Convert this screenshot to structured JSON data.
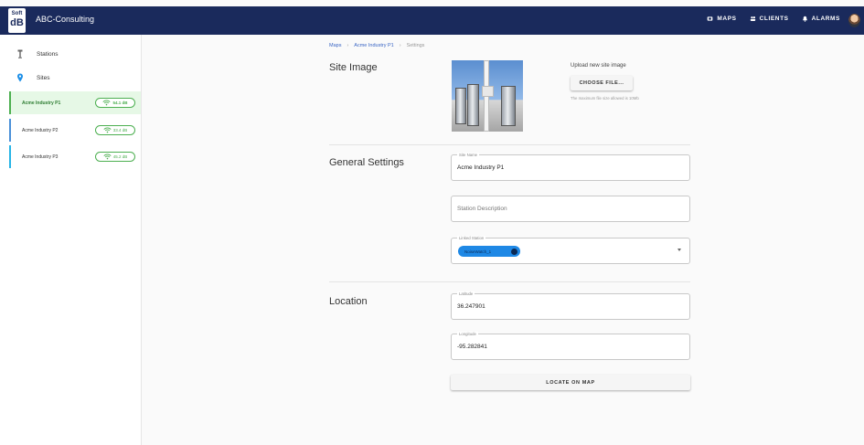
{
  "app": {
    "logo_top": "Soft",
    "logo_bottom": "dB",
    "title": "ABC-Consulting"
  },
  "topnav": [
    {
      "label": "MAPS",
      "icon": "map-icon"
    },
    {
      "label": "CLIENTS",
      "icon": "people-icon"
    },
    {
      "label": "ALARMS",
      "icon": "bell-icon"
    }
  ],
  "sidebar": {
    "stations_label": "Stations",
    "sites_label": "Sites",
    "sites": [
      {
        "name": "Acme Industry P1",
        "signal": "54.1 dB"
      },
      {
        "name": "Acme Industry P2",
        "signal": "33.4 dB"
      },
      {
        "name": "Acme Industry P3",
        "signal": "45.2 dB"
      }
    ]
  },
  "breadcrumb": [
    "Maps",
    "Acme Industry P1",
    "Settings"
  ],
  "site_image": {
    "title": "Site Image",
    "upload_label": "Upload new site image",
    "choose_button": "CHOOSE FILE...",
    "note": "The maximum file size allowed is 10Mb"
  },
  "general": {
    "title": "General Settings",
    "site_name_label": "Site Name",
    "site_name_value": "Acme Industry P1",
    "description_placeholder": "Station Description",
    "linked_label": "Linked Station",
    "linked_tag": "NoiseWatch_1"
  },
  "location": {
    "title": "Location",
    "latitude_label": "Latitude",
    "latitude_value": "36.247901",
    "longitude_label": "Longitude",
    "longitude_value": "-95.282841",
    "locate_button": "LOCATE ON MAP"
  },
  "colors": {
    "topbar": "#1a2a5c",
    "selected_bg": "#e6f8e6",
    "signal_green": "#4caf50",
    "tag_blue": "#1e88e5",
    "link_blue": "#3a66c4"
  }
}
